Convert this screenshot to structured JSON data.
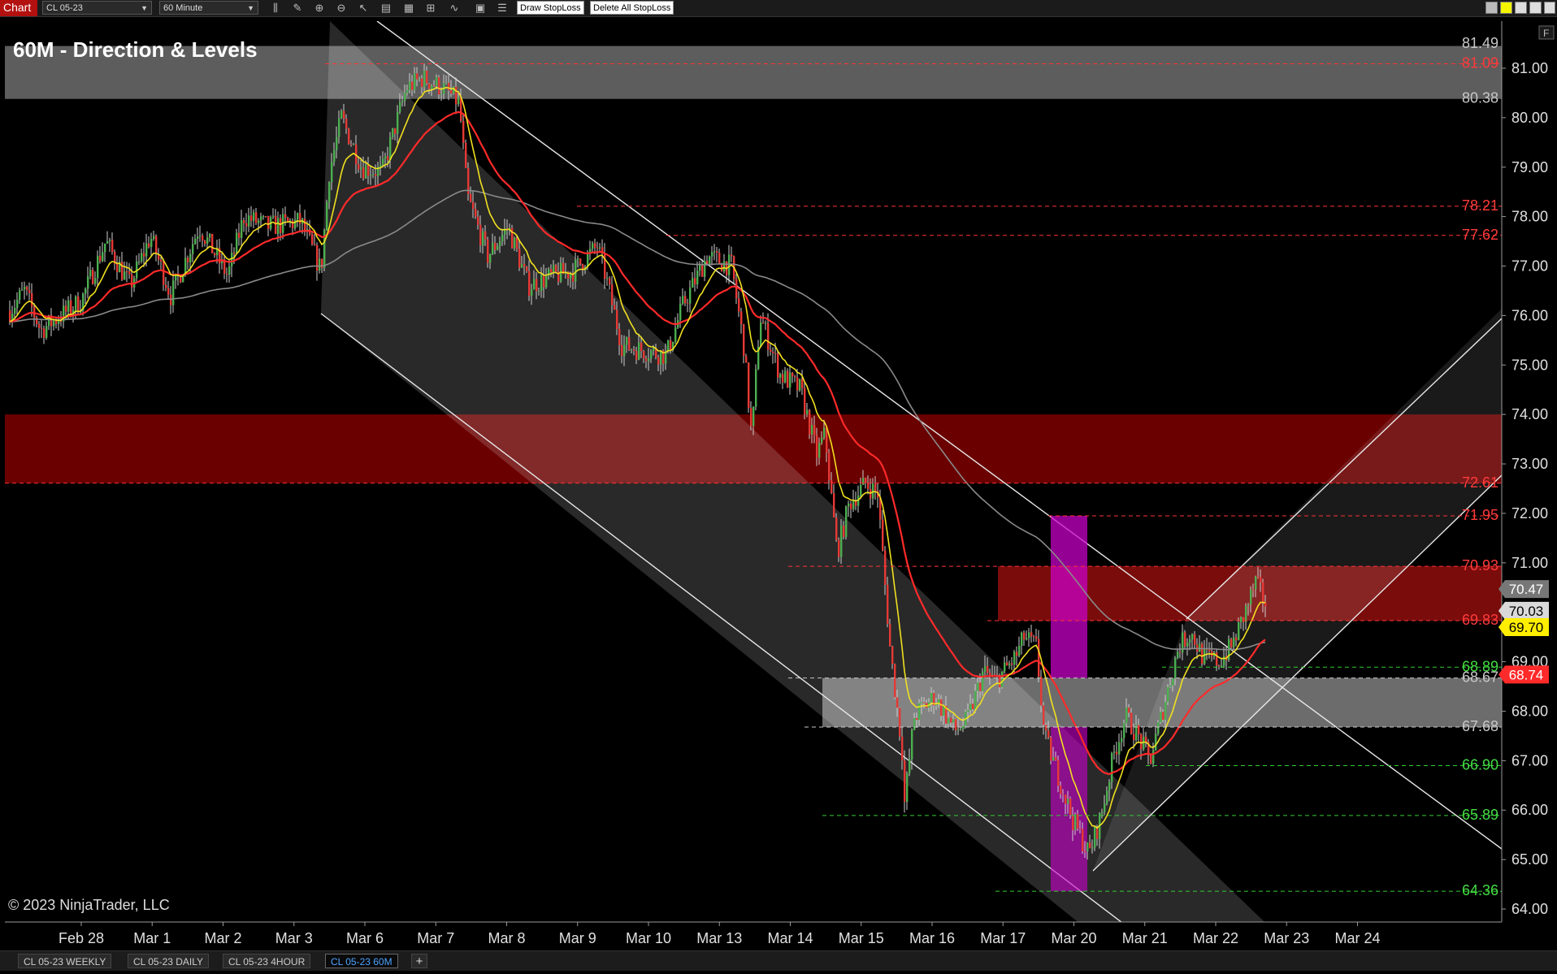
{
  "toolbar": {
    "app_label": "Chart",
    "instrument": "CL 05-23",
    "period": "60 Minute",
    "draw_stoploss": "Draw StopLoss",
    "delete_stoploss": "Delete All StopLoss"
  },
  "chart": {
    "title": "60M - Direction & Levels",
    "copyright": "© 2023 NinjaTrader, LLC",
    "f_button": "F",
    "colors": {
      "background": "#000000",
      "up_candle": "#4caf50",
      "down_candle": "#e53935",
      "support": "#33cc33",
      "resistance": "#ff3333"
    },
    "y_ticks": [
      "81.00",
      "80.00",
      "79.00",
      "78.00",
      "77.00",
      "76.00",
      "75.00",
      "74.00",
      "73.00",
      "72.00",
      "71.00",
      "70.00",
      "69.00",
      "68.00",
      "67.00",
      "66.00",
      "65.00",
      "64.00"
    ],
    "x_labels": [
      "Feb 28",
      "Mar 1",
      "Mar 2",
      "Mar 3",
      "Mar 6",
      "Mar 7",
      "Mar 8",
      "Mar 9",
      "Mar 10",
      "Mar 13",
      "Mar 14",
      "Mar 15",
      "Mar 16",
      "Mar 17",
      "Mar 20",
      "Mar 21",
      "Mar 22",
      "Mar 23",
      "Mar 24"
    ],
    "level_labels": [
      {
        "value": "81.49",
        "color": "gray"
      },
      {
        "value": "81.09",
        "color": "red"
      },
      {
        "value": "80.38",
        "color": "gray"
      },
      {
        "value": "78.21",
        "color": "red"
      },
      {
        "value": "77.62",
        "color": "red"
      },
      {
        "value": "72.61",
        "color": "red"
      },
      {
        "value": "71.95",
        "color": "red"
      },
      {
        "value": "70.93",
        "color": "red"
      },
      {
        "value": "69.83",
        "color": "red"
      },
      {
        "value": "68.89",
        "color": "green"
      },
      {
        "value": "68.67",
        "color": "gray"
      },
      {
        "value": "67.68",
        "color": "gray"
      },
      {
        "value": "66.90",
        "color": "green"
      },
      {
        "value": "65.89",
        "color": "green"
      },
      {
        "value": "64.36",
        "color": "green"
      }
    ],
    "price_badges": [
      {
        "value": "70.47",
        "style": "gray"
      },
      {
        "value": "70.03",
        "style": "light"
      },
      {
        "value": "69.70",
        "style": "yellow"
      },
      {
        "value": "68.74",
        "style": "red"
      }
    ]
  },
  "tabs": [
    {
      "label": "CL 05-23 WEEKLY"
    },
    {
      "label": "CL 05-23 DAILY"
    },
    {
      "label": "CL 05-23 4HOUR"
    },
    {
      "label": "CL 05-23 60M",
      "active": true
    }
  ],
  "tab_add": "+"
}
